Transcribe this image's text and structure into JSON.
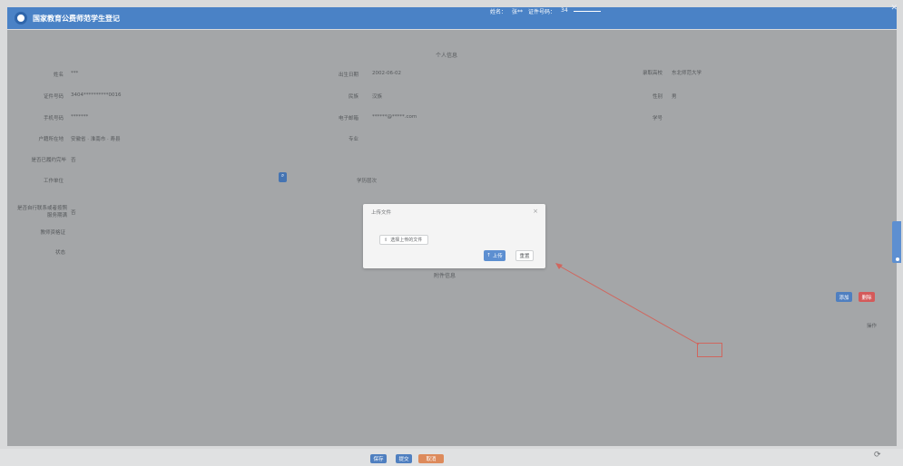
{
  "header": {
    "app_title": "国家教育公费师范学生登记",
    "user_name_label": "姓名：",
    "user_name": "张**",
    "id_label": "证件号码：",
    "id_value": "34",
    "close_icon": "close-icon"
  },
  "form": {
    "section1_title": "个人信息",
    "name_label": "姓名",
    "name_value": "***",
    "birth_label": "出生日期",
    "birth_value": "2002-06-02",
    "ethnic_label": "民族",
    "ethnic_value": "汉族",
    "school_label": "录取高校",
    "school_value": "东北师范大学",
    "id_label": "证件号码",
    "id_value": "3404**********0016",
    "gender_label": "性别",
    "gender_value": "男",
    "student_label": "学号",
    "student_value": "",
    "phone_label": "手机号码",
    "phone_value": "*******",
    "email_label": "电子邮箱",
    "email_value": "******@*****.com",
    "major_label": "专业",
    "major_value": "",
    "address_label": "户籍所在地",
    "address_value": "安徽省 · 淮南市 · 寿县",
    "education_label": "学历层次",
    "education_value": "",
    "fulfilled_label": "是否已履约完毕",
    "fulfilled_value": "否",
    "work_unit_label": "工作单位",
    "work_unit_value": "",
    "question_label": "是否自行联系或者按照服务期满",
    "question_value": "否",
    "cert_label": "教师资格证",
    "cert_value": "",
    "status_label": "状态",
    "status_value": "",
    "section2_title": "附件信息"
  },
  "table": {
    "row_info_left": "",
    "row_info_right": "",
    "add_button": "添加",
    "delete_button": "删除",
    "link_text": "",
    "headers": [
      "",
      "",
      "",
      "",
      "",
      "",
      "",
      "操作"
    ],
    "row": {
      "c1": "",
      "c2": "",
      "c3": "",
      "c4": "",
      "c5": "",
      "c6": "",
      "c7": "",
      "actions_top": "",
      "actions_bottom": ""
    }
  },
  "modal": {
    "title": "上传文件",
    "select_file_label": "选择上传的文件",
    "upload_label": "上传",
    "reset_label": "重置",
    "close_icon": "close-icon"
  },
  "footer": {
    "left_text": "",
    "save_button": "保存",
    "submit_button": "提交",
    "cancel_button": "取消",
    "right_text": ""
  },
  "colors": {
    "header_blue": "#4a82c6",
    "button_blue": "#4f7fc0",
    "button_red": "#d45a5a",
    "button_orange": "#dd8a5b",
    "annotation_red": "#d0665e"
  }
}
